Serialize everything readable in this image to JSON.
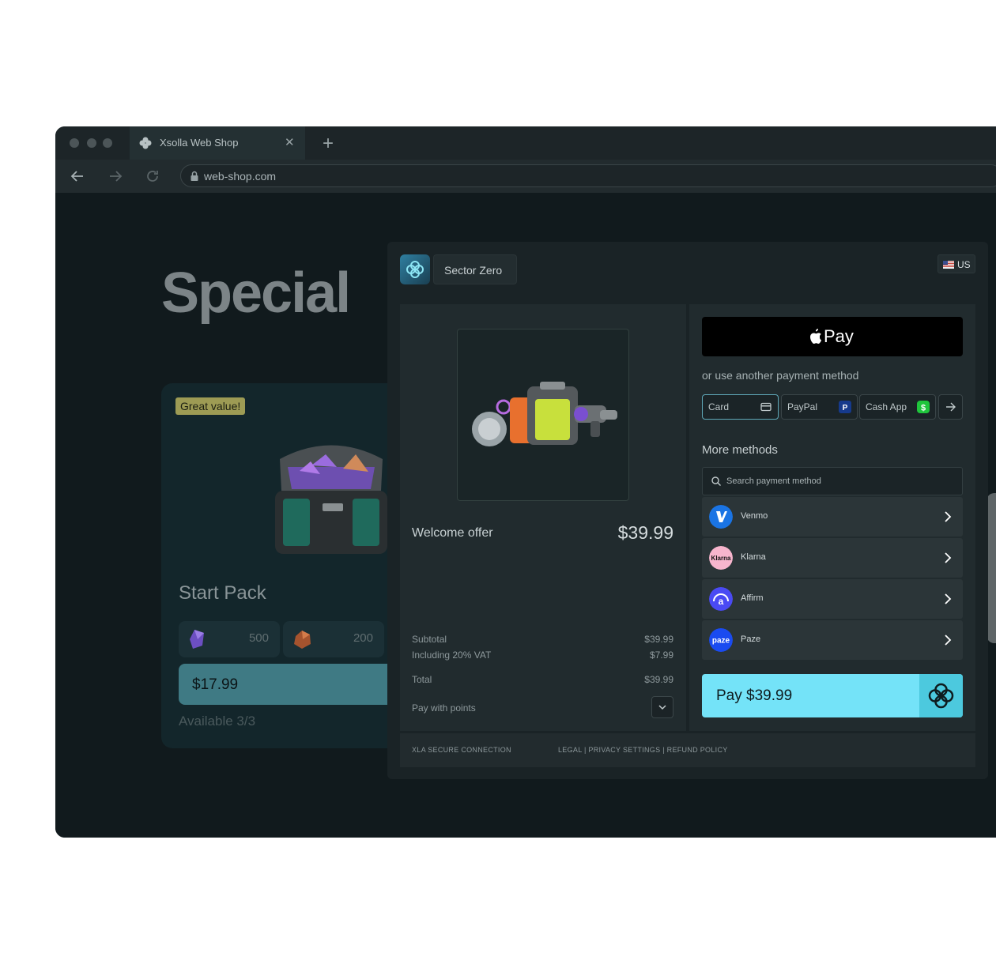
{
  "browser": {
    "tab_title": "Xsolla Web Shop",
    "url": "web-shop.com"
  },
  "shop": {
    "hero_title": "Special",
    "card": {
      "badge": "Great value!",
      "name": "Start Pack",
      "resources": [
        {
          "icon": "purple-crystal-icon",
          "qty": "500"
        },
        {
          "icon": "orange-ore-icon",
          "qty": "200"
        }
      ],
      "price": "$17.99",
      "availability": "Available 3/3"
    }
  },
  "checkout": {
    "game_name": "Sector Zero",
    "country": "US",
    "offer_name": "Welcome offer",
    "offer_price": "$39.99",
    "summary": {
      "subtotal_label": "Subtotal",
      "subtotal_value": "$39.99",
      "vat_label": "Including 20% VAT",
      "vat_value": "$7.99",
      "total_label": "Total",
      "total_value": "$39.99",
      "points_label": "Pay with points"
    },
    "apple_pay_label": "Pay",
    "alt_methods_text": "or use another payment method",
    "quick_methods": [
      {
        "label": "Card",
        "icon": "card-icon"
      },
      {
        "label": "PayPal",
        "icon": "paypal-icon"
      },
      {
        "label": "Cash App",
        "icon": "cash-app-icon"
      }
    ],
    "more_methods_title": "More methods",
    "search_placeholder": "Search payment method",
    "methods": [
      {
        "name": "Venmo",
        "logo_text": "V",
        "color": "#1a74e4"
      },
      {
        "name": "Klarna",
        "logo_text": "Klarna",
        "color": "#f7b5cd"
      },
      {
        "name": "Affirm",
        "logo_text": "a",
        "color": "#4a4af4"
      },
      {
        "name": "Paze",
        "logo_text": "paze",
        "color": "#1a4bf0"
      }
    ],
    "pay_button": "Pay $39.99",
    "footer": {
      "secure": "XLA SECURE CONNECTION",
      "links": "LEGAL | PRIVACY SETTINGS | REFUND POLICY"
    }
  },
  "colors": {
    "accent": "#74e3f8",
    "badge": "#9d9b54",
    "background": "#111a1d"
  }
}
